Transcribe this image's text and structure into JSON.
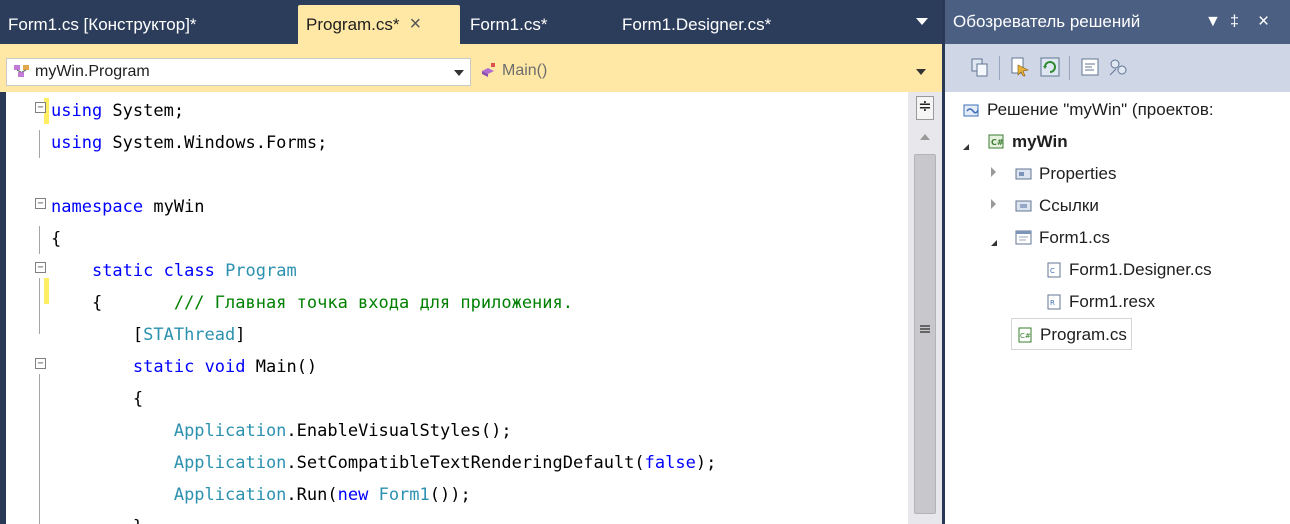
{
  "editor": {
    "tabs": [
      {
        "label": "Form1.cs [Конструктор]*",
        "active": false
      },
      {
        "label": "Program.cs*",
        "active": true,
        "close": "×"
      },
      {
        "label": "Form1.cs*",
        "active": false
      },
      {
        "label": "Form1.Designer.cs*",
        "active": false
      }
    ],
    "nav": {
      "type_combo": "myWin.Program",
      "member_combo": "Main()"
    },
    "splitter_glyph": "≑",
    "fold_minus": "−",
    "code_lines": [
      {
        "parts": [
          {
            "t": "using",
            "c": "kw"
          },
          {
            "t": " System;",
            "c": ""
          }
        ]
      },
      {
        "parts": [
          {
            "t": "using",
            "c": "kw"
          },
          {
            "t": " System.Windows.Forms;",
            "c": ""
          }
        ]
      },
      {
        "parts": []
      },
      {
        "parts": [
          {
            "t": "namespace",
            "c": "kw"
          },
          {
            "t": " myWin",
            "c": ""
          }
        ]
      },
      {
        "parts": [
          {
            "t": "{",
            "c": ""
          }
        ]
      },
      {
        "parts": [
          {
            "t": "    ",
            "c": ""
          },
          {
            "t": "static",
            "c": "kw"
          },
          {
            "t": " ",
            "c": ""
          },
          {
            "t": "class",
            "c": "kw"
          },
          {
            "t": " ",
            "c": ""
          },
          {
            "t": "Program",
            "c": "ty"
          }
        ]
      },
      {
        "parts": [
          {
            "t": "    {       ",
            "c": ""
          },
          {
            "t": "/// Главная точка входа для приложения.",
            "c": "cm"
          }
        ]
      },
      {
        "parts": [
          {
            "t": "        [",
            "c": ""
          },
          {
            "t": "STAThread",
            "c": "ty"
          },
          {
            "t": "]",
            "c": ""
          }
        ]
      },
      {
        "parts": [
          {
            "t": "        ",
            "c": ""
          },
          {
            "t": "static",
            "c": "kw"
          },
          {
            "t": " ",
            "c": ""
          },
          {
            "t": "void",
            "c": "kw"
          },
          {
            "t": " Main()",
            "c": ""
          }
        ]
      },
      {
        "parts": [
          {
            "t": "        {",
            "c": ""
          }
        ]
      },
      {
        "parts": [
          {
            "t": "            ",
            "c": ""
          },
          {
            "t": "Application",
            "c": "ty"
          },
          {
            "t": ".EnableVisualStyles();",
            "c": ""
          }
        ]
      },
      {
        "parts": [
          {
            "t": "            ",
            "c": ""
          },
          {
            "t": "Application",
            "c": "ty"
          },
          {
            "t": ".SetCompatibleTextRenderingDefault(",
            "c": ""
          },
          {
            "t": "false",
            "c": "kw"
          },
          {
            "t": ");",
            "c": ""
          }
        ]
      },
      {
        "parts": [
          {
            "t": "            ",
            "c": ""
          },
          {
            "t": "Application",
            "c": "ty"
          },
          {
            "t": ".Run(",
            "c": ""
          },
          {
            "t": "new",
            "c": "kw"
          },
          {
            "t": " ",
            "c": ""
          },
          {
            "t": "Form1",
            "c": "ty"
          },
          {
            "t": "());",
            "c": ""
          }
        ]
      },
      {
        "parts": [
          {
            "t": "        }",
            "c": ""
          }
        ]
      }
    ]
  },
  "explorer": {
    "title": "Обозреватель решений",
    "title_controls": {
      "dropdown": "▼",
      "pin": "‡",
      "close": "×"
    },
    "tree": {
      "solution": "Решение \"myWin\"  (проектов:",
      "project": "myWin",
      "properties": "Properties",
      "references": "Ссылки",
      "form1": "Form1.cs",
      "form1_designer": "Form1.Designer.cs",
      "form1_resx": "Form1.resx",
      "program": "Program.cs"
    }
  },
  "colors": {
    "tab_bg": "#2c3d5b",
    "active_tab": "#ffe8a6",
    "keyword": "#0000ff",
    "type": "#2b91af",
    "comment": "#008000",
    "explorer_title": "#4b5f83"
  }
}
